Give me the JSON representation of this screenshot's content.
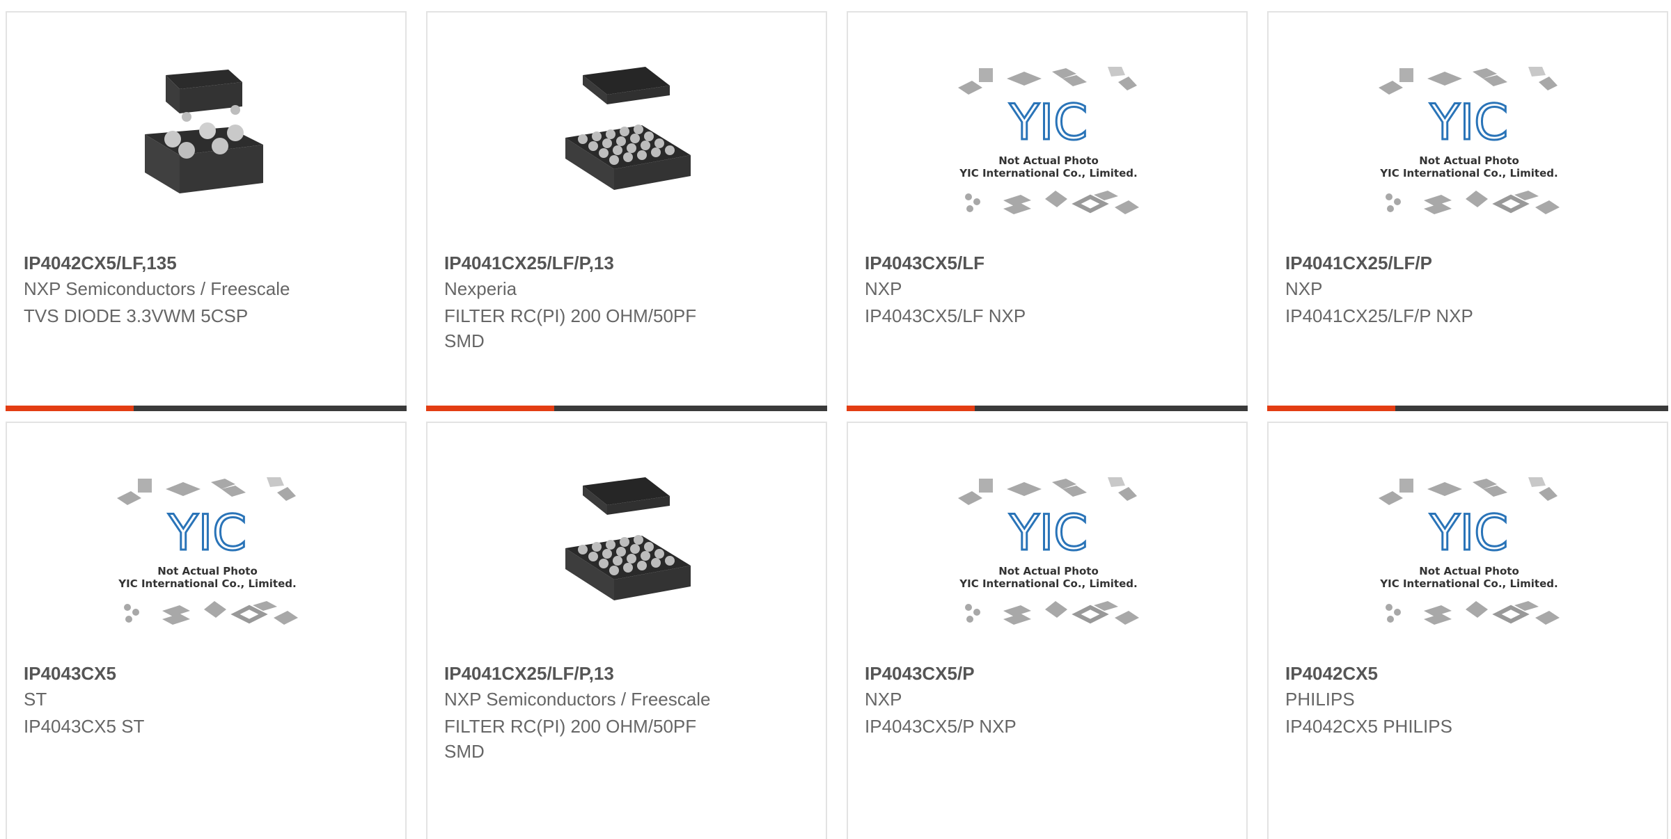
{
  "colors": {
    "accent": "#e33d13",
    "bar": "#3a3a3a",
    "border": "#e3e3e3",
    "logo": "#2a74b8"
  },
  "products": [
    {
      "title": "IP4042CX5/LF,135",
      "maker": "NXP Semiconductors / Freescale",
      "desc": "TVS DIODE 3.3VWM 5CSP",
      "image": "csp-5-ball"
    },
    {
      "title": "IP4041CX25/LF/P,13",
      "maker": "Nexperia",
      "desc": "FILTER RC(PI) 200 OHM/50PF SMD",
      "image": "bga-25-ball"
    },
    {
      "title": "IP4043CX5/LF",
      "maker": "NXP",
      "desc": "IP4043CX5/LF NXP",
      "image": "placeholder"
    },
    {
      "title": "IP4041CX25/LF/P",
      "maker": "NXP",
      "desc": "IP4041CX25/LF/P NXP",
      "image": "placeholder"
    },
    {
      "title": "IP4043CX5",
      "maker": "ST",
      "desc": "IP4043CX5 ST",
      "image": "placeholder"
    },
    {
      "title": "IP4041CX25/LF/P,13",
      "maker": "NXP Semiconductors / Freescale",
      "desc": "FILTER RC(PI) 200 OHM/50PF SMD",
      "image": "bga-25-ball"
    },
    {
      "title": "IP4043CX5/P",
      "maker": "NXP",
      "desc": "IP4043CX5/P NXP",
      "image": "placeholder"
    },
    {
      "title": "IP4042CX5",
      "maker": "PHILIPS",
      "desc": "IP4042CX5 PHILIPS",
      "image": "placeholder"
    }
  ],
  "placeholder": {
    "logo_text": "YIC",
    "caption_line1": "Not Actual Photo",
    "caption_line2": "YIC International Co., Limited."
  }
}
